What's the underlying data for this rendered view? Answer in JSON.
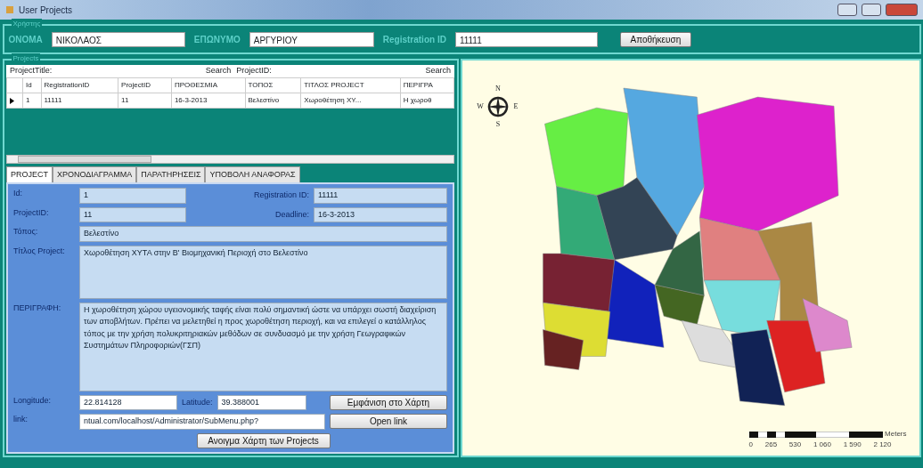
{
  "window": {
    "title": "User Projects"
  },
  "user": {
    "group_title": "Χρήστης",
    "fields": [
      {
        "label": "ΟΝΟΜΑ",
        "value": "ΝΙΚΟΛΑΟΣ"
      },
      {
        "label": "ΕΠΩΝΥΜΟ",
        "value": "ΑΡΓΥΡΙΟΥ"
      },
      {
        "label": "Registration ID",
        "value": "11111"
      }
    ],
    "button": "Αποθήκευση"
  },
  "projects": {
    "group_title": "Projects",
    "search": [
      {
        "label": "ProjectTitle:",
        "button": "Search"
      },
      {
        "label": "ProjectID:",
        "button": "Search"
      }
    ],
    "table": {
      "columns": [
        "Id",
        "RegistrationID",
        "ProjectID",
        "ΠΡΟΘΕΣΜΙΑ",
        "ΤΟΠΟΣ",
        "ΤΙΤΛΟΣ PROJECT",
        "ΠΕΡΙΓΡΑ"
      ],
      "rows": [
        {
          "selected": true,
          "cells": [
            "1",
            "11111",
            "11",
            "16-3-2013",
            "Βελεστίνο",
            "Χωροθέτηση ΧΥ...",
            "Η χωροθ"
          ]
        }
      ]
    },
    "tabs": [
      {
        "label": "PROJECT",
        "selected": true
      },
      {
        "label": "ΧΡΟΝΟΔΙΑΓΡΑΜΜΑ",
        "selected": false
      },
      {
        "label": "ΠΑΡΑΤΗΡΗΣΕΙΣ",
        "selected": false
      },
      {
        "label": "ΥΠΟΒΟΛΗ ΑΝΑΦΟΡΑΣ",
        "selected": false
      }
    ],
    "form": {
      "id": {
        "label": "Id:",
        "value": "1"
      },
      "registration_id": {
        "label": "Registration ID:",
        "value": "11111"
      },
      "project_id": {
        "label": "ProjectID:",
        "value": "11"
      },
      "deadline": {
        "label": "Deadline:",
        "value": "16-3-2013"
      },
      "place": {
        "label": "Τόπος:",
        "value": "Βελεστίνο"
      },
      "title": {
        "label": "Τίτλος Project:",
        "value": "Χωροθέτηση ΧΥΤΑ στην Β' Βιομηχανική Περιοχή στο Βελεστίνο"
      },
      "description": {
        "label": "ΠΕΡΙΓΡΑΦΗ:",
        "value": "Η χωροθέτηση χώρου υγειονομικής ταφής είναι πολύ σημαντική ώστε να υπάρχει σωστή διαχείριση των αποβλήτων. Πρέπει να μελετηθεί η προς χωροθέτηση περιοχή, και να επιλεγεί ο κατάλληλος τόπος με την χρήση πολυκριτηριακών μεθόδων σε συνδυασμό με την χρήση Γεωγραφικών Συστημάτων Πληροφοριών(ΓΣΠ)"
      },
      "longitude": {
        "label": "Longitude:",
        "value": "22.814128"
      },
      "latitude": {
        "label": "Latitude:",
        "value": "39.388001"
      },
      "link": {
        "label": "link:",
        "value": "ntual.com/localhost/Administrator/SubMenu.php?"
      },
      "show_button": "Εμφάνιση στο Χάρτη",
      "open_button": "Open link",
      "map_button": "Ανοιγμα Χάρτη των Projects"
    }
  },
  "map": {
    "compass": [
      "N",
      "W",
      "E",
      "S"
    ],
    "scale": {
      "unit": "Meters",
      "labels": [
        "0",
        "265",
        "530",
        "1 060",
        "1 590",
        "2 120"
      ]
    }
  }
}
